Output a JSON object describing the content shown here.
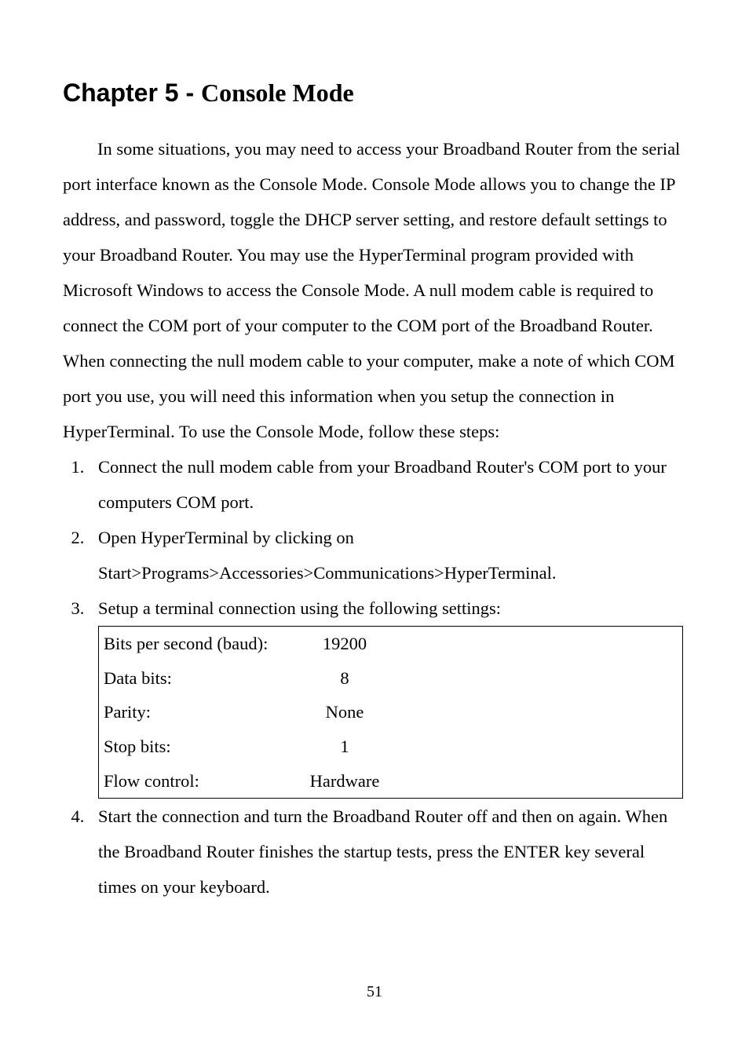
{
  "heading": {
    "bold": "Chapter 5 - ",
    "title": "Console Mode"
  },
  "intro": "In some situations, you may need to access your Broadband Router from the serial port interface known as the Console Mode. Console Mode allows you to change the IP address, and password, toggle the DHCP server setting, and restore default settings to your Broadband Router. You may use the HyperTerminal program provided with Microsoft Windows to access the Console Mode. A null modem cable is required to connect the COM port of your computer to the COM port of the Broadband Router. When connecting the null modem cable to your computer, make a note of which COM port you use, you will need this information when you setup the connection in HyperTerminal. To use the Console Mode, follow these steps:",
  "steps": {
    "s1": "Connect the null modem cable from your Broadband Router's COM port to your computers COM port.",
    "s2": "Open HyperTerminal by clicking on Start>Programs>Accessories>Communications>HyperTerminal.",
    "s3": "Setup a terminal connection using the following settings:",
    "s4": "Start the connection and turn the Broadband Router off and then on again. When the Broadband Router finishes the startup tests, press the ENTER key several times on your keyboard."
  },
  "settings": {
    "rows": [
      {
        "label": "Bits per second (baud):",
        "value": "19200"
      },
      {
        "label": "Data bits:",
        "value": "8"
      },
      {
        "label": "Parity:",
        "value": "None"
      },
      {
        "label": "Stop bits:",
        "value": "1"
      },
      {
        "label": "Flow control:",
        "value": "Hardware"
      }
    ]
  },
  "page_number": "51"
}
